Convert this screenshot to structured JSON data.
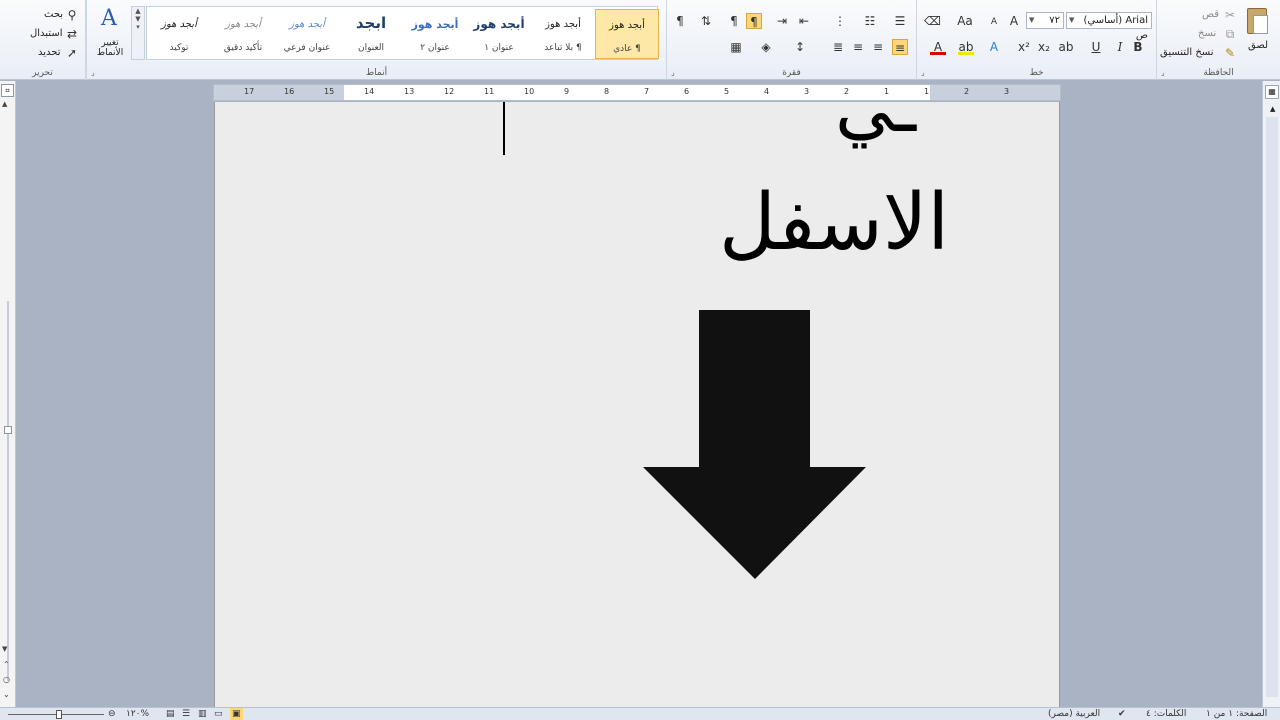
{
  "ribbon": {
    "clipboard": {
      "label": "الحافظة",
      "paste": "لصق",
      "cut": "قص",
      "copy": "نسخ",
      "format_painter": "نسخ التنسيق"
    },
    "font": {
      "label": "خط",
      "font_name": "Arial (أساسي) ص",
      "font_size": "٧٢",
      "bold": "B",
      "italic": "I",
      "underline": "U",
      "grow": "A",
      "shrink": "A",
      "change_case": "Aa"
    },
    "paragraph": {
      "label": "فقرة"
    },
    "styles": {
      "label": "أنماط",
      "items": [
        {
          "sample": "أبجد هوز",
          "name": "¶ عادي"
        },
        {
          "sample": "أبجد هوز",
          "name": "¶ بلا تباعد"
        },
        {
          "sample": "أبجد هوز",
          "name": "عنوان ١"
        },
        {
          "sample": "أبجد هوز",
          "name": "عنوان ٢"
        },
        {
          "sample": "ابجد",
          "name": "العنوان"
        },
        {
          "sample": "أبجد هوز",
          "name": "عنوان فرعي"
        },
        {
          "sample": "أبجد هوز",
          "name": "تأكيد دقيق"
        },
        {
          "sample": "أبجد هوز",
          "name": "توكيد"
        }
      ],
      "change_styles": "تغيير الأنماط"
    },
    "editing": {
      "label": "تحرير",
      "find": "بحث",
      "replace": "استبدال",
      "select": "تحديد"
    }
  },
  "ruler": {
    "numbers": [
      "17",
      "16",
      "15",
      "14",
      "13",
      "12",
      "11",
      "10",
      "9",
      "8",
      "7",
      "6",
      "5",
      "4",
      "3",
      "2",
      "1",
      "1",
      "2",
      "3"
    ]
  },
  "document": {
    "line1": "ـي",
    "line2": "الاسفل"
  },
  "status": {
    "page": "الصفحة: ١ من ١",
    "words": "الكلمات: ٤",
    "language": "العربية (مصر)",
    "zoom": "%١٢٠"
  },
  "colors": {
    "ribbon_bg": "#e9eef6",
    "page_bg": "#ececec",
    "selected_style": "#fde8a8",
    "arrow": "#111111"
  }
}
